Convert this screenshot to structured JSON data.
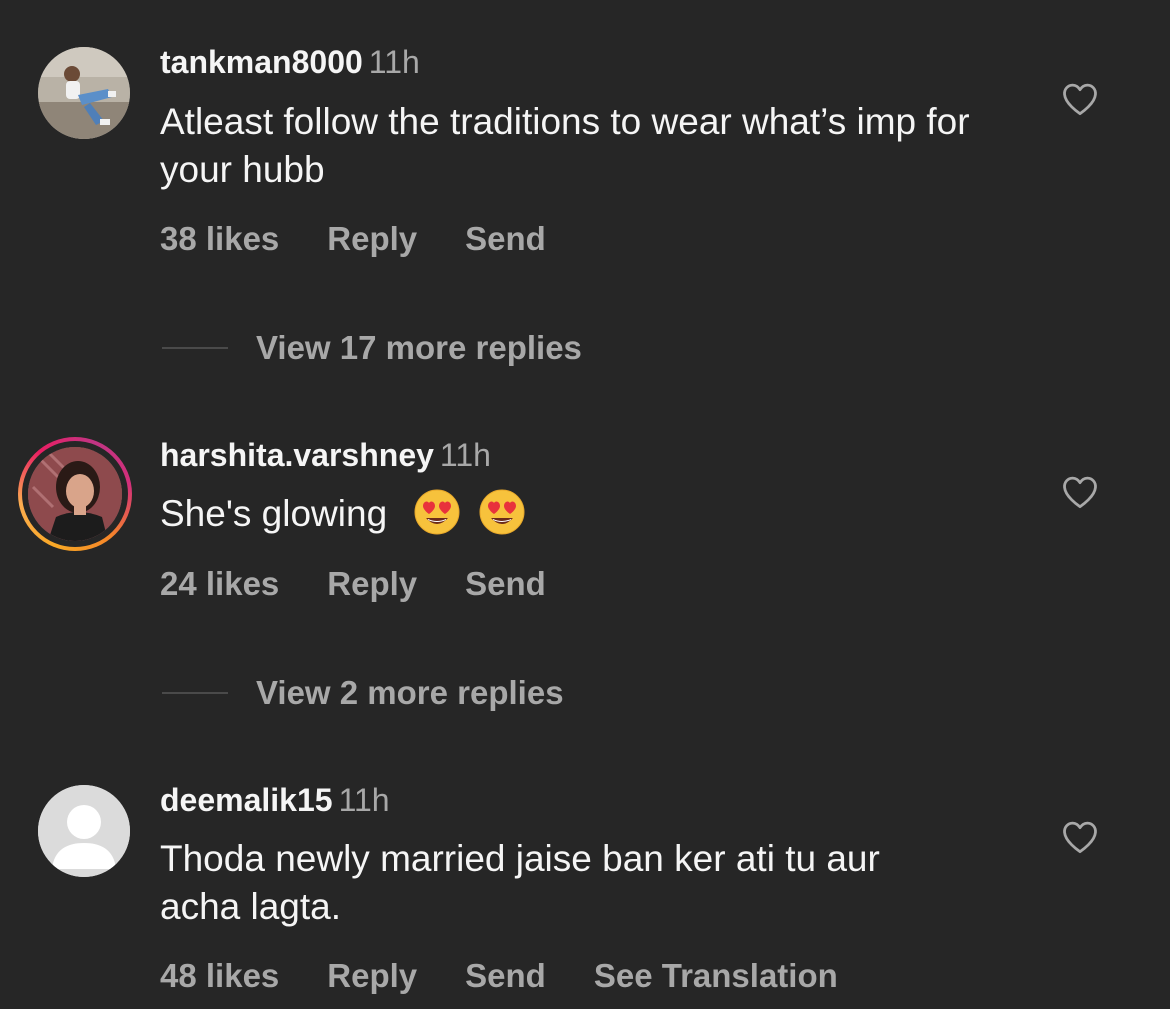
{
  "comments": [
    {
      "username": "tankman8000",
      "time": "11h",
      "text": "Atleast follow the traditions to wear what’s imp for your hubb",
      "likes": "38 likes",
      "reply": "Reply",
      "send": "Send",
      "view_more": "View 17 more replies",
      "avatar": "photo-man-sitting"
    },
    {
      "username": "harshita.varshney",
      "time": "11h",
      "text": "She's glowing",
      "emojis": [
        "heart-eyes-emoji",
        "heart-eyes-emoji"
      ],
      "likes": "24 likes",
      "reply": "Reply",
      "send": "Send",
      "view_more": "View 2 more replies",
      "avatar": "photo-woman-story-ring"
    },
    {
      "username": "deemalik15",
      "time": "11h",
      "text": "Thoda newly married jaise ban ker ati tu aur acha lagta.",
      "likes": "48 likes",
      "reply": "Reply",
      "send": "Send",
      "see_translation": "See Translation",
      "avatar": "default-avatar"
    }
  ],
  "icons": {
    "like": "heart-outline-icon"
  },
  "colors": {
    "background": "#262626",
    "primary_text": "#f5f5f5",
    "secondary_text": "#a8a8a8"
  }
}
